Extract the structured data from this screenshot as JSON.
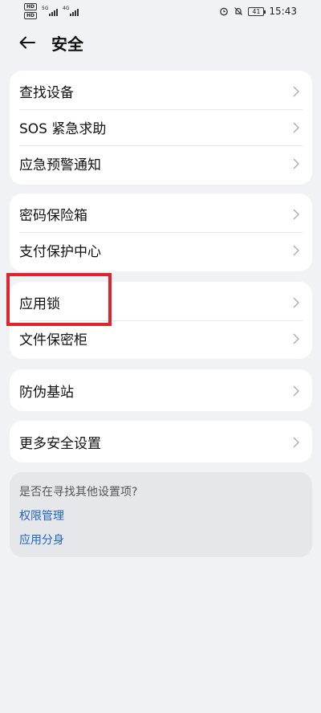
{
  "status": {
    "hd_top": "HD",
    "hd_bottom": "HD",
    "net1": "5G",
    "net2": "4G",
    "battery": "41",
    "time": "15:43"
  },
  "header": {
    "title": "安全"
  },
  "groups": [
    [
      "查找设备",
      "SOS 紧急求助",
      "应急预警通知"
    ],
    [
      "密码保险箱",
      "支付保护中心"
    ],
    [
      "应用锁",
      "文件保密柜"
    ],
    [
      "防伪基站"
    ],
    [
      "更多安全设置"
    ]
  ],
  "suggest": {
    "question": "是否在寻找其他设置项?",
    "links": [
      "权限管理",
      "应用分身"
    ]
  },
  "colors": {
    "highlight": "#e0242b",
    "link": "#1f64c8"
  }
}
